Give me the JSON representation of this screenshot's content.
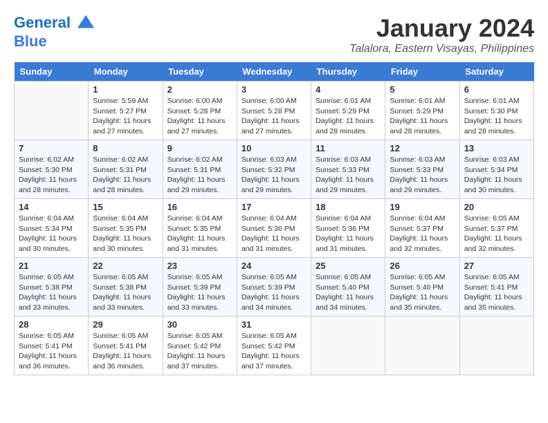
{
  "header": {
    "logo_line1": "General",
    "logo_line2": "Blue",
    "month_title": "January 2024",
    "location": "Talalora, Eastern Visayas, Philippines"
  },
  "days_of_week": [
    "Sunday",
    "Monday",
    "Tuesday",
    "Wednesday",
    "Thursday",
    "Friday",
    "Saturday"
  ],
  "weeks": [
    [
      {
        "num": "",
        "sunrise": "",
        "sunset": "",
        "daylight": ""
      },
      {
        "num": "1",
        "sunrise": "Sunrise: 5:59 AM",
        "sunset": "Sunset: 5:27 PM",
        "daylight": "Daylight: 11 hours and 27 minutes."
      },
      {
        "num": "2",
        "sunrise": "Sunrise: 6:00 AM",
        "sunset": "Sunset: 5:28 PM",
        "daylight": "Daylight: 11 hours and 27 minutes."
      },
      {
        "num": "3",
        "sunrise": "Sunrise: 6:00 AM",
        "sunset": "Sunset: 5:28 PM",
        "daylight": "Daylight: 11 hours and 27 minutes."
      },
      {
        "num": "4",
        "sunrise": "Sunrise: 6:01 AM",
        "sunset": "Sunset: 5:29 PM",
        "daylight": "Daylight: 11 hours and 28 minutes."
      },
      {
        "num": "5",
        "sunrise": "Sunrise: 6:01 AM",
        "sunset": "Sunset: 5:29 PM",
        "daylight": "Daylight: 11 hours and 28 minutes."
      },
      {
        "num": "6",
        "sunrise": "Sunrise: 6:01 AM",
        "sunset": "Sunset: 5:30 PM",
        "daylight": "Daylight: 11 hours and 28 minutes."
      }
    ],
    [
      {
        "num": "7",
        "sunrise": "Sunrise: 6:02 AM",
        "sunset": "Sunset: 5:30 PM",
        "daylight": "Daylight: 11 hours and 28 minutes."
      },
      {
        "num": "8",
        "sunrise": "Sunrise: 6:02 AM",
        "sunset": "Sunset: 5:31 PM",
        "daylight": "Daylight: 11 hours and 28 minutes."
      },
      {
        "num": "9",
        "sunrise": "Sunrise: 6:02 AM",
        "sunset": "Sunset: 5:31 PM",
        "daylight": "Daylight: 11 hours and 29 minutes."
      },
      {
        "num": "10",
        "sunrise": "Sunrise: 6:03 AM",
        "sunset": "Sunset: 5:32 PM",
        "daylight": "Daylight: 11 hours and 29 minutes."
      },
      {
        "num": "11",
        "sunrise": "Sunrise: 6:03 AM",
        "sunset": "Sunset: 5:33 PM",
        "daylight": "Daylight: 11 hours and 29 minutes."
      },
      {
        "num": "12",
        "sunrise": "Sunrise: 6:03 AM",
        "sunset": "Sunset: 5:33 PM",
        "daylight": "Daylight: 11 hours and 29 minutes."
      },
      {
        "num": "13",
        "sunrise": "Sunrise: 6:03 AM",
        "sunset": "Sunset: 5:34 PM",
        "daylight": "Daylight: 11 hours and 30 minutes."
      }
    ],
    [
      {
        "num": "14",
        "sunrise": "Sunrise: 6:04 AM",
        "sunset": "Sunset: 5:34 PM",
        "daylight": "Daylight: 11 hours and 30 minutes."
      },
      {
        "num": "15",
        "sunrise": "Sunrise: 6:04 AM",
        "sunset": "Sunset: 5:35 PM",
        "daylight": "Daylight: 11 hours and 30 minutes."
      },
      {
        "num": "16",
        "sunrise": "Sunrise: 6:04 AM",
        "sunset": "Sunset: 5:35 PM",
        "daylight": "Daylight: 11 hours and 31 minutes."
      },
      {
        "num": "17",
        "sunrise": "Sunrise: 6:04 AM",
        "sunset": "Sunset: 5:36 PM",
        "daylight": "Daylight: 11 hours and 31 minutes."
      },
      {
        "num": "18",
        "sunrise": "Sunrise: 6:04 AM",
        "sunset": "Sunset: 5:36 PM",
        "daylight": "Daylight: 11 hours and 31 minutes."
      },
      {
        "num": "19",
        "sunrise": "Sunrise: 6:04 AM",
        "sunset": "Sunset: 5:37 PM",
        "daylight": "Daylight: 11 hours and 32 minutes."
      },
      {
        "num": "20",
        "sunrise": "Sunrise: 6:05 AM",
        "sunset": "Sunset: 5:37 PM",
        "daylight": "Daylight: 11 hours and 32 minutes."
      }
    ],
    [
      {
        "num": "21",
        "sunrise": "Sunrise: 6:05 AM",
        "sunset": "Sunset: 5:38 PM",
        "daylight": "Daylight: 11 hours and 33 minutes."
      },
      {
        "num": "22",
        "sunrise": "Sunrise: 6:05 AM",
        "sunset": "Sunset: 5:38 PM",
        "daylight": "Daylight: 11 hours and 33 minutes."
      },
      {
        "num": "23",
        "sunrise": "Sunrise: 6:05 AM",
        "sunset": "Sunset: 5:39 PM",
        "daylight": "Daylight: 11 hours and 33 minutes."
      },
      {
        "num": "24",
        "sunrise": "Sunrise: 6:05 AM",
        "sunset": "Sunset: 5:39 PM",
        "daylight": "Daylight: 11 hours and 34 minutes."
      },
      {
        "num": "25",
        "sunrise": "Sunrise: 6:05 AM",
        "sunset": "Sunset: 5:40 PM",
        "daylight": "Daylight: 11 hours and 34 minutes."
      },
      {
        "num": "26",
        "sunrise": "Sunrise: 6:05 AM",
        "sunset": "Sunset: 5:40 PM",
        "daylight": "Daylight: 11 hours and 35 minutes."
      },
      {
        "num": "27",
        "sunrise": "Sunrise: 6:05 AM",
        "sunset": "Sunset: 5:41 PM",
        "daylight": "Daylight: 11 hours and 35 minutes."
      }
    ],
    [
      {
        "num": "28",
        "sunrise": "Sunrise: 6:05 AM",
        "sunset": "Sunset: 5:41 PM",
        "daylight": "Daylight: 11 hours and 36 minutes."
      },
      {
        "num": "29",
        "sunrise": "Sunrise: 6:05 AM",
        "sunset": "Sunset: 5:41 PM",
        "daylight": "Daylight: 11 hours and 36 minutes."
      },
      {
        "num": "30",
        "sunrise": "Sunrise: 6:05 AM",
        "sunset": "Sunset: 5:42 PM",
        "daylight": "Daylight: 11 hours and 37 minutes."
      },
      {
        "num": "31",
        "sunrise": "Sunrise: 6:05 AM",
        "sunset": "Sunset: 5:42 PM",
        "daylight": "Daylight: 11 hours and 37 minutes."
      },
      {
        "num": "",
        "sunrise": "",
        "sunset": "",
        "daylight": ""
      },
      {
        "num": "",
        "sunrise": "",
        "sunset": "",
        "daylight": ""
      },
      {
        "num": "",
        "sunrise": "",
        "sunset": "",
        "daylight": ""
      }
    ]
  ]
}
